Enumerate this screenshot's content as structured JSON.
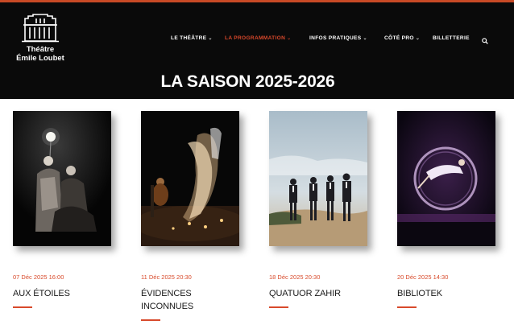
{
  "site": {
    "logo_line1": "Théâtre",
    "logo_line2": "Émile Loubet"
  },
  "nav": {
    "items": [
      {
        "label": "LE THÉÂTRE",
        "has_dropdown": true,
        "active": false
      },
      {
        "label": "LA PROGRAMMATION",
        "has_dropdown": true,
        "active": true
      },
      {
        "label": "INFOS PRATIQUES",
        "has_dropdown": true,
        "active": false
      },
      {
        "label": "CÔTÉ PRO",
        "has_dropdown": true,
        "active": false
      },
      {
        "label": "BILLETTERIE",
        "has_dropdown": false,
        "active": false
      }
    ],
    "search_icon": "search-icon"
  },
  "page": {
    "title": "LA SAISON 2025-2026"
  },
  "shows": [
    {
      "date": "07 Déc 2025 16:00",
      "title": "AUX ÉTOILES"
    },
    {
      "date": "11 Déc 2025 20:30",
      "title": "ÉVIDENCES INCONNUES"
    },
    {
      "date": "18 Déc 2025 20:30",
      "title": "QUATUOR ZAHIR"
    },
    {
      "date": "20 Déc 2025 14:30",
      "title": "BIBLIOTEK"
    }
  ],
  "colors": {
    "accent": "#d84a2b",
    "header_bg": "#0a0a0a"
  }
}
